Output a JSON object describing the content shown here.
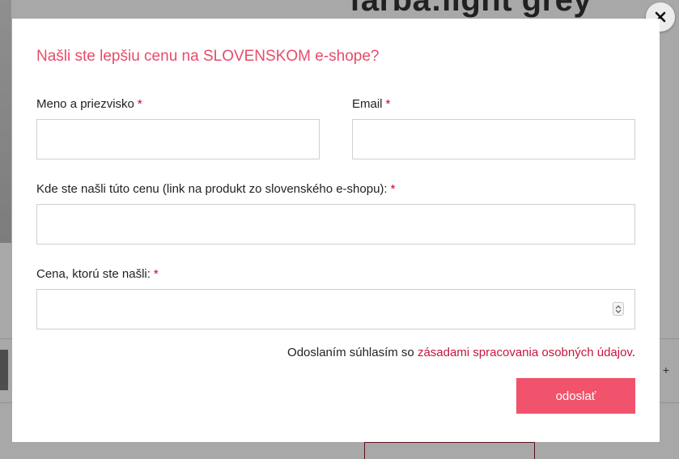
{
  "background": {
    "heading": "farba:light grey",
    "plus_symbol": "+"
  },
  "modal": {
    "title": "Našli ste lepšiu cenu na SLOVENSKOM e-shope?",
    "close_icon": "close-icon",
    "fields": {
      "name": {
        "label": "Meno a priezvisko",
        "required_mark": "*",
        "value": ""
      },
      "email": {
        "label": "Email",
        "required_mark": "*",
        "value": ""
      },
      "link": {
        "label": "Kde ste našli túto cenu (link na produkt zo slovenského e-shopu):",
        "required_mark": "*",
        "value": ""
      },
      "price": {
        "label": "Cena, ktorú ste našli:",
        "required_mark": "*",
        "value": ""
      }
    },
    "consent": {
      "text": "Odoslaním súhlasím so ",
      "link_text": "zásadami spracovania osobných údajov",
      "suffix": "."
    },
    "submit_label": "odoslať"
  },
  "colors": {
    "title": "#e74c68",
    "required": "#d0021b",
    "link": "#c5163f",
    "submit_bg": "#f0536b"
  }
}
